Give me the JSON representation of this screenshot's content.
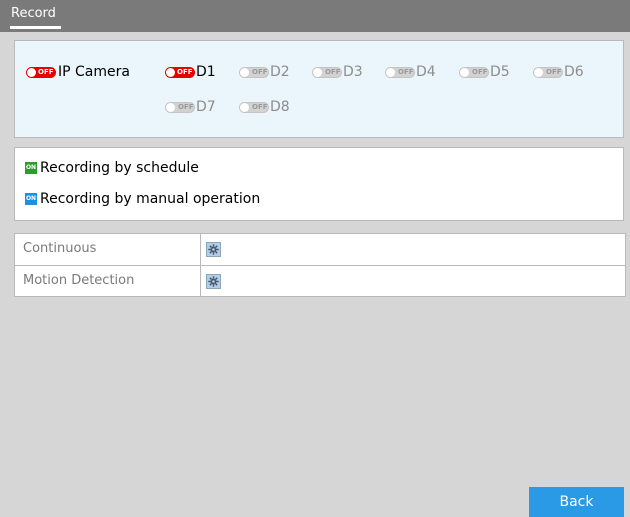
{
  "header": {
    "title": "Record"
  },
  "cameras": {
    "master": {
      "label": "IP Camera",
      "state": "OFF"
    },
    "channels": [
      {
        "label": "D1",
        "state": "OFF",
        "active": true
      },
      {
        "label": "D2",
        "state": "OFF",
        "active": false
      },
      {
        "label": "D3",
        "state": "OFF",
        "active": false
      },
      {
        "label": "D4",
        "state": "OFF",
        "active": false
      },
      {
        "label": "D5",
        "state": "OFF",
        "active": false
      },
      {
        "label": "D6",
        "state": "OFF",
        "active": false
      },
      {
        "label": "D7",
        "state": "OFF",
        "active": false
      },
      {
        "label": "D8",
        "state": "OFF",
        "active": false
      }
    ]
  },
  "legend": {
    "schedule": {
      "badge": "ON",
      "label": "Recording by schedule",
      "color": "#2e9b2e"
    },
    "manual": {
      "badge": "ON",
      "label": "Recording by manual operation",
      "color": "#1e90e0"
    }
  },
  "schedule_table": {
    "rows": [
      {
        "label": "Continuous",
        "icon": "gear-icon"
      },
      {
        "label": "Motion Detection",
        "icon": "gear-icon"
      }
    ]
  },
  "footer": {
    "back_label": "Back"
  },
  "colors": {
    "title_bar": "#7a7a7a",
    "toggle_off_active": "#e60000",
    "toggle_off_inactive": "#d2d2d2",
    "back_button": "#2a9ae6"
  }
}
